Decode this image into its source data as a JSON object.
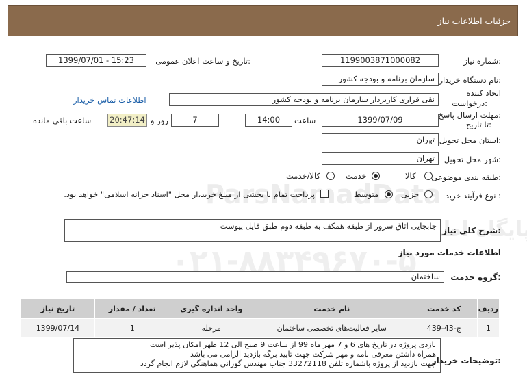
{
  "header": {
    "title": "جزئیات اطلاعات نیاز"
  },
  "labels": {
    "need_number": "شماره نیاز:",
    "announce_datetime": "تاریخ و ساعت اعلان عمومی:",
    "buyer_org": "نام دستگاه خریدار:",
    "creator_line1": "ایجاد کننده",
    "creator_line2": "درخواست:",
    "deadline_line1": "مهلت ارسال پاسخ:",
    "deadline_line2": "تا تاریخ:",
    "time": "ساعت",
    "days_and": "روز و",
    "remaining": "ساعت باقی مانده",
    "province": "استان محل تحویل:",
    "city": "شهر محل تحویل:",
    "category": "طبقه بندی موضوعی:",
    "purchase_type": "نوع فرآیند خرید :",
    "summary": "شرح کلی نیاز:",
    "services_info": "اطلاعات خدمات مورد نیاز",
    "service_group": "گروه خدمت:",
    "buyer_notes": "توضیحات خریدار:"
  },
  "fields": {
    "need_number": "1199003871000082",
    "announce_datetime": "1399/07/01 - 15:23",
    "buyer_org": "سازمان برنامه و بودجه کشور",
    "creator": "نقی قراری کاربرداز سازمان برنامه و بودجه کشور",
    "contact_link": "اطلاعات تماس خریدار",
    "deadline_date": "1399/07/09",
    "deadline_time": "14:00",
    "days": "7",
    "remaining_time": "20:47:14",
    "province": "تهران",
    "city": "تهران",
    "summary": "جابجایی اتاق سرور از طبقه همکف به طبقه دوم طبق فایل پیوست",
    "service_group": "ساختمان"
  },
  "category_options": [
    {
      "label": "کالا",
      "selected": false
    },
    {
      "label": "خدمت",
      "selected": true
    },
    {
      "label": "کالا/خدمت",
      "selected": false
    }
  ],
  "purchase_options": [
    {
      "label": "جزیی",
      "selected": false
    },
    {
      "label": "متوسط",
      "selected": true
    }
  ],
  "payment_note": "پرداخت تمام یا بخشی از مبلغ خرید،از محل \"اسناد خزانه اسلامی\" خواهد بود.",
  "table": {
    "headers": [
      "ردیف",
      "کد خدمت",
      "نام خدمت",
      "واحد اندازه گیری",
      "تعداد / مقدار",
      "تاریخ نیاز"
    ],
    "rows": [
      [
        "1",
        "ج-43-439",
        "سایر فعالیت‌های تخصصی ساختمان",
        "مرحله",
        "1",
        "1399/07/14"
      ]
    ]
  },
  "notes": [
    "بازدی پروژه در تاریخ های 6 و 7 مهر ماه 99 از ساعت 9 صبح الی 12 ظهر امکان پذیر است",
    "همراه داشتن معرفی نامه و مهر شرکت جهت تایید برگه بازدید الزامی می باشد",
    "جهت بازدید از پروژه باشماره تلفن 33272118 جناب مهندس گورانی هماهنگی لازم انجام گردد"
  ],
  "watermark": {
    "line1": "ParsNamadData",
    "line2": "پایگاه اطلاع رسانی مناقصه ومزایده",
    "line3": "۰۲۱-۸۸۳۴۹۶۷۰-۵"
  }
}
